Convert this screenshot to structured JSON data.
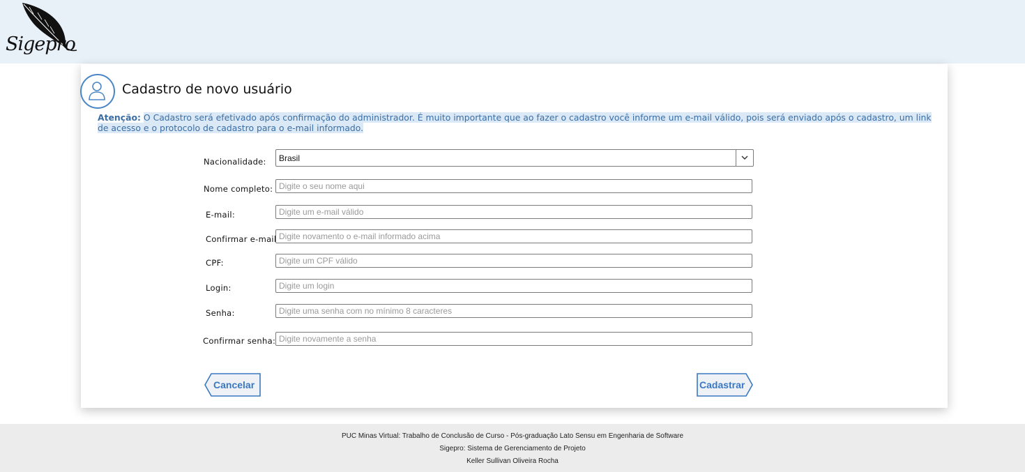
{
  "header": {
    "logo_text": "Sigepro"
  },
  "form": {
    "title": "Cadastro de novo usuário",
    "notice_label": "Atenção:",
    "notice_text": "O Cadastro será efetivado após confirmação do administrador. É muito importante que ao fazer o cadastro você informe um e-mail válido, pois será enviado após o cadastro, um link de acesso e o protocolo de cadastro para o e-mail informado.",
    "nationality": {
      "label": "Nacionalidade:",
      "value": "Brasil"
    },
    "fields": [
      {
        "label": "Nome completo:",
        "placeholder": "Digite o seu nome aqui"
      },
      {
        "label": "E-mail:",
        "placeholder": "Digite um e-mail válido"
      },
      {
        "label": "Confirmar e-mail:",
        "placeholder": "Digite novamento o e-mail informado acima"
      },
      {
        "label": "CPF:",
        "placeholder": "Digite um CPF válido"
      },
      {
        "label": "Login:",
        "placeholder": "Digite um login"
      },
      {
        "label": "Senha:",
        "placeholder": "Digite uma senha com no mínimo 8 caracteres"
      },
      {
        "label": "Confirmar senha:",
        "placeholder": "Digite novamente a senha"
      }
    ],
    "cancel_label": "Cancelar",
    "submit_label": "Cadastrar"
  },
  "footer": {
    "line1": "PUC Minas Virtual: Trabalho de Conclusão de Curso - Pós-graduação Lato Sensu em Engenharia de Software",
    "line2": "Sigepro: Sistema de Gerenciamento de Projeto",
    "line3": "Keller Sullivan Oliveira Rocha"
  },
  "colors": {
    "accent": "#3a78c2",
    "header_bg": "#e8f0f8",
    "footer_bg": "#ececec"
  }
}
